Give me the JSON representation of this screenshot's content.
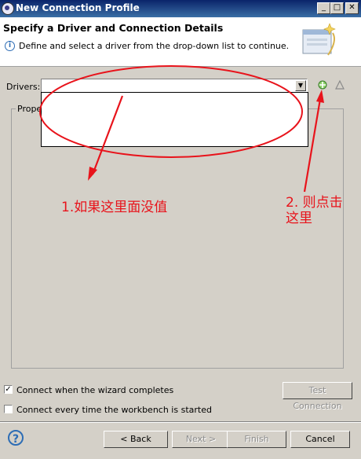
{
  "window": {
    "title": "New Connection Profile"
  },
  "header": {
    "title": "Specify a Driver and Connection Details",
    "description": "Define and select a driver from the drop-down list to continue."
  },
  "drivers": {
    "label": "Drivers:",
    "value": ""
  },
  "properties": {
    "label": "Propert"
  },
  "options": {
    "connect_when_complete": {
      "label": "Connect when the wizard completes",
      "checked": true
    },
    "connect_every_time": {
      "label": "Connect every time the workbench is started",
      "checked": false
    }
  },
  "buttons": {
    "test_connection": "Test Connection",
    "back": "< Back",
    "next": "Next >",
    "finish": "Finish",
    "cancel": "Cancel"
  },
  "annotations": {
    "note1": "1.如果这里面没值",
    "note2_line1": "2. 则点击",
    "note2_line2": "这里",
    "color": "#e8131b"
  },
  "icons": {
    "app": "eclipse-icon",
    "info": "info-icon",
    "add_driver": "new-driver-icon",
    "edit_driver": "edit-driver-icon",
    "help": "help-icon"
  }
}
